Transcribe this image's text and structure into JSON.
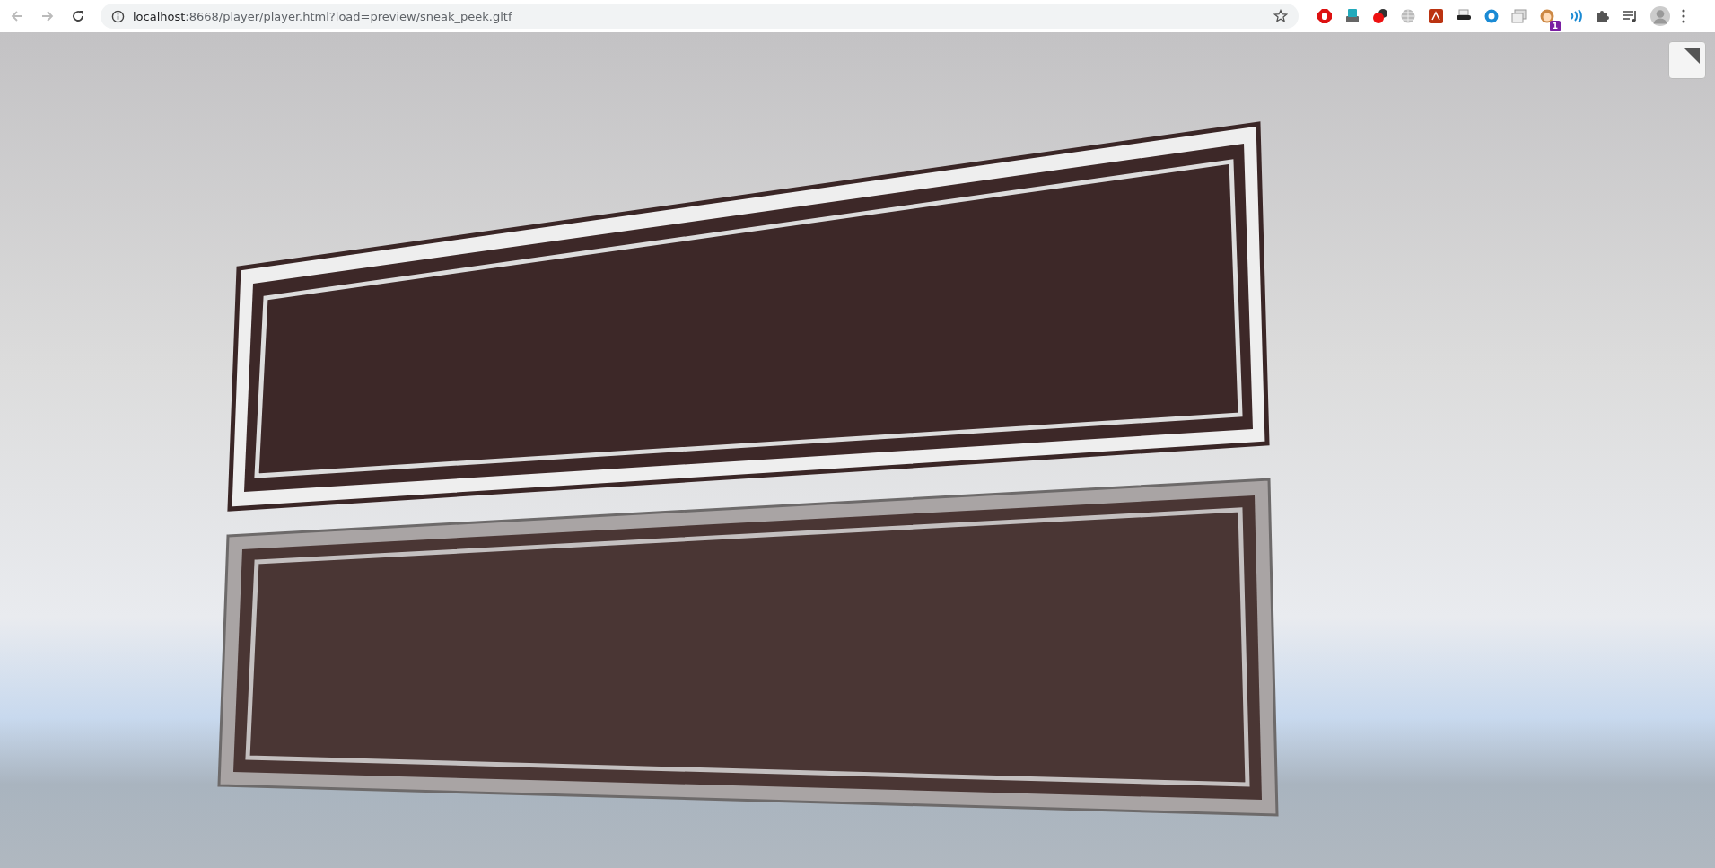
{
  "browser": {
    "url_host": "localhost",
    "url_path": ":8668/player/player.html?load=preview/sneak_peek.gltf",
    "extension_badge": "1"
  }
}
